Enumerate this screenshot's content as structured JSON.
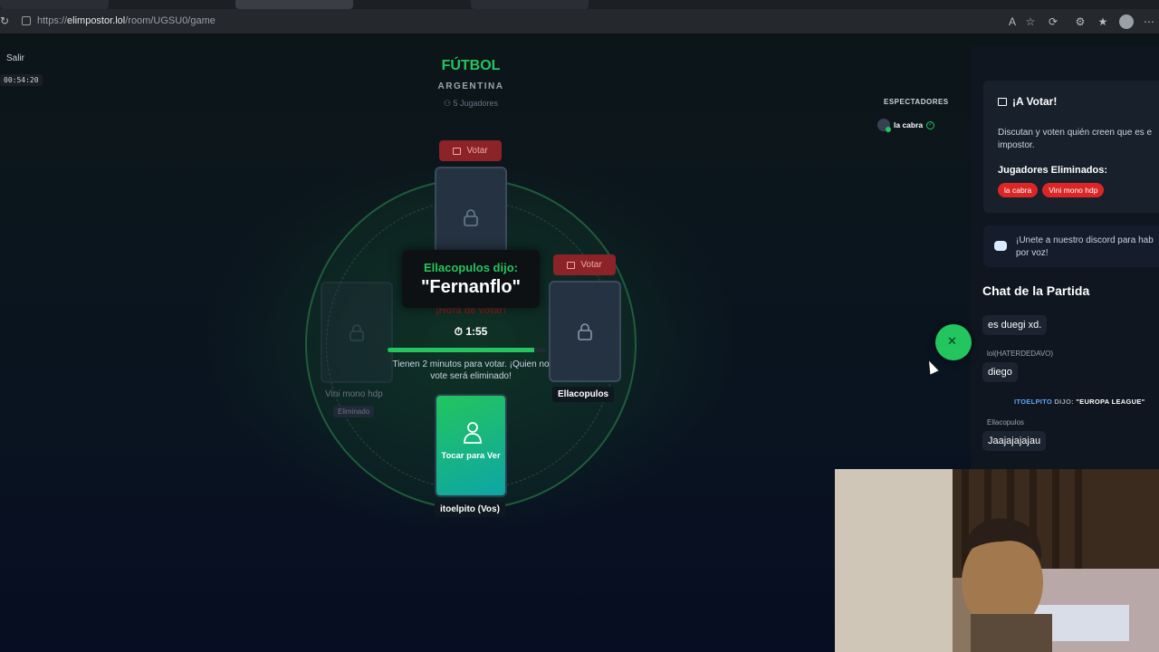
{
  "browser": {
    "url_prefix": "https://",
    "url_host": "elimpostor.lol",
    "url_path": "/room/UGSU0/game"
  },
  "game": {
    "exit_label": "Salir",
    "elapsed": "00:54:20",
    "category": "FÚTBOL",
    "subcategory": "ARGENTINA",
    "players_count": "5 Jugadores",
    "vote_label": "Votar",
    "said_who": "Ellacopulos dijo:",
    "said_word": "\"Fernanflo\"",
    "hora_text": "¡Hora de votar!",
    "countdown": "1:55",
    "countdown_progress": 0.92,
    "vote_message": "Tienen 2 minutos para votar. ¡Quien no vote será eliminado!",
    "player_left_name": "Vini mono hdp",
    "player_left_status": "Eliminado",
    "player_right_name": "Ellacopulos",
    "me_name": "itoelpito (Vos)",
    "me_card_text": "Tocar para Ver"
  },
  "spectators": {
    "title": "ESPECTADORES",
    "items": [
      {
        "initial": "L",
        "name": "la cabra"
      }
    ]
  },
  "panel": {
    "vote_title": "¡A Votar!",
    "vote_desc_line1": "Discutan y voten quién creen que es e",
    "vote_desc_line2": "impostor.",
    "eliminated_title": "Jugadores Eliminados:",
    "eliminated": [
      "la cabra",
      "Vini mono hdp"
    ],
    "discord_line1": "¡Unete a nuestro discord para hab",
    "discord_line2": "por voz!",
    "chat_title": "Chat de la Partida",
    "messages": [
      {
        "author": "",
        "text": "es duegi xd."
      },
      {
        "author": "lol(HATERDEDAVO)",
        "text": "diego"
      },
      {
        "author": "Ellacopulos",
        "text": "Jaajajajajau"
      }
    ],
    "system_msg": {
      "who": "ITOELPITO",
      "dijo": "DIJO:",
      "word": "\"EUROPA LEAGUE\""
    }
  },
  "colors": {
    "accent": "#22c55e",
    "danger": "#dc2626",
    "vote": "#8b2328"
  },
  "icons": [
    "reload-icon",
    "lock-icon",
    "vote-icon",
    "timer-icon",
    "person-icon",
    "discord-icon",
    "users-icon",
    "check-icon",
    "close-icon"
  ]
}
